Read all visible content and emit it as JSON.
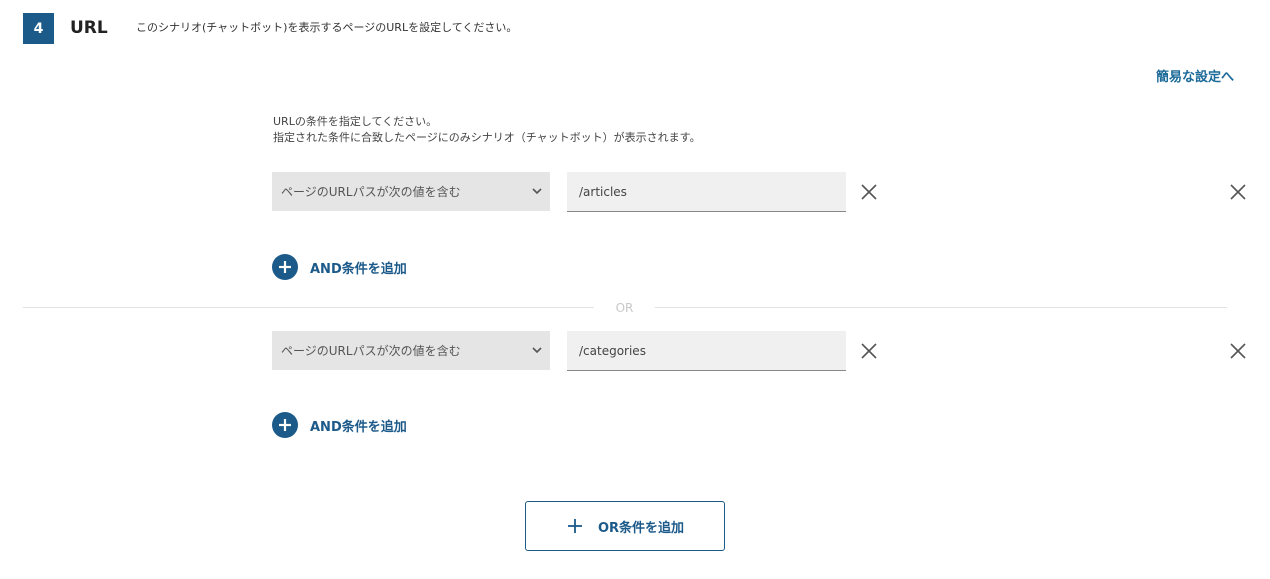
{
  "section": {
    "step_number": "4",
    "title": "URL",
    "description": "このシナリオ(チャットボット)を表示するページのURLを設定してください。"
  },
  "simple_settings_link": "簡易な設定へ",
  "instructions": {
    "line1": "URLの条件を指定してください。",
    "line2": "指定された条件に合致したページにのみシナリオ（チャットボット）が表示されます。"
  },
  "or_groups": [
    {
      "conditions": [
        {
          "operator": "ページのURLパスが次の値を含む",
          "value": "/articles"
        }
      ],
      "add_and_label": "AND条件を追加"
    },
    {
      "conditions": [
        {
          "operator": "ページのURLパスが次の値を含む",
          "value": "/categories"
        }
      ],
      "add_and_label": "AND条件を追加"
    }
  ],
  "or_separator": "OR",
  "add_or_label": "OR条件を追加",
  "colors": {
    "accent": "#1c5a8a",
    "link": "#1c6a99",
    "select_bg": "#e5e5e5",
    "input_bg": "#f0f0f0"
  },
  "icons": {
    "select_chevron": "chevron-down-icon",
    "remove_condition": "close-icon",
    "remove_group": "close-icon",
    "add": "plus-icon"
  }
}
